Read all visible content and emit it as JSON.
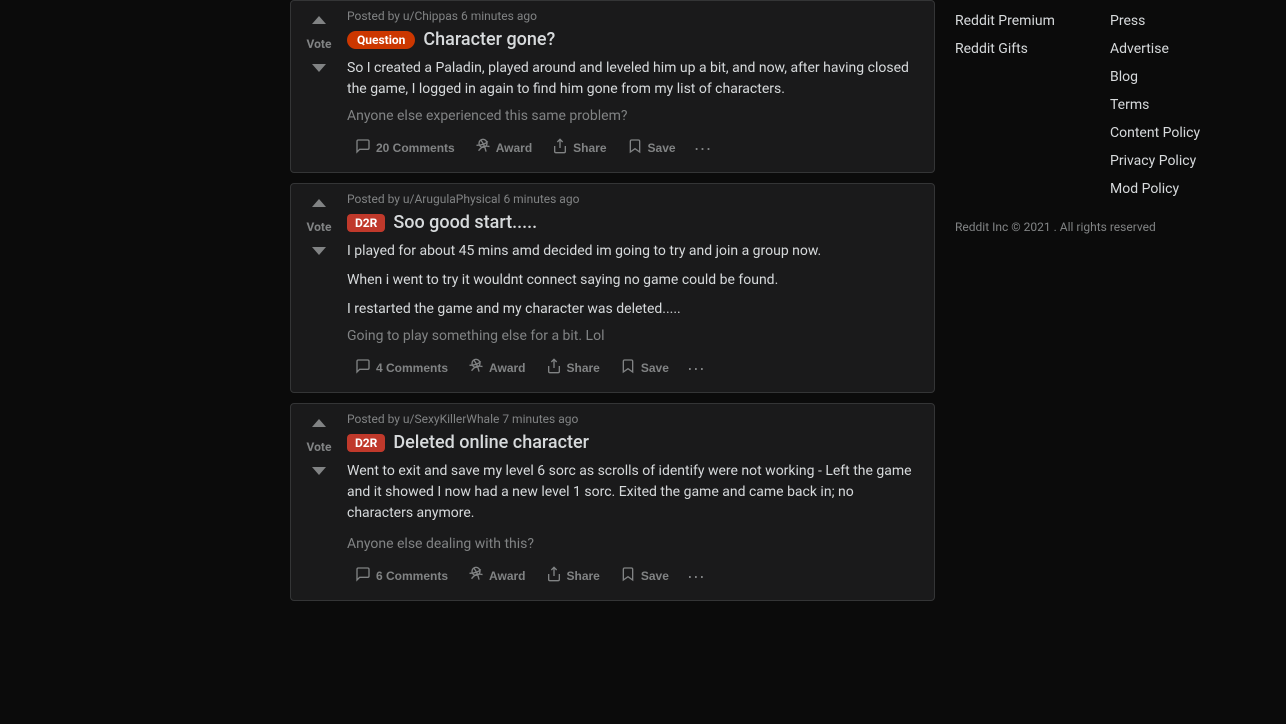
{
  "sidebar": {
    "links_col1": [
      {
        "label": "Reddit Premium",
        "name": "reddit-premium-link"
      },
      {
        "label": "Reddit Gifts",
        "name": "reddit-gifts-link"
      }
    ],
    "links_col2": [
      {
        "label": "Press",
        "name": "press-link"
      },
      {
        "label": "Advertise",
        "name": "advertise-link"
      },
      {
        "label": "Blog",
        "name": "blog-link"
      },
      {
        "label": "Terms",
        "name": "terms-link"
      },
      {
        "label": "Content Policy",
        "name": "content-policy-link"
      },
      {
        "label": "Privacy Policy",
        "name": "privacy-policy-link"
      },
      {
        "label": "Mod Policy",
        "name": "mod-policy-link"
      }
    ],
    "footer": "Reddit Inc © 2021 . All rights reserved"
  },
  "posts": [
    {
      "id": "post-1",
      "meta": "Posted by u/Chippas 6 minutes ago",
      "flair": "Question",
      "flair_type": "question",
      "title": "Character gone?",
      "body1": "So I created a Paladin, played around and leveled him up a bit, and now, after having closed the game, I logged in again to find him gone from my list of characters.",
      "subtext": "Anyone else experienced this same problem?",
      "comments_label": "20 Comments",
      "award_label": "Award",
      "share_label": "Share",
      "save_label": "Save"
    },
    {
      "id": "post-2",
      "meta": "Posted by u/ArugulaPhysical 6 minutes ago",
      "flair": "D2R",
      "flair_type": "d2r",
      "title": "Soo good start.....",
      "body1": "I played for about 45 mins amd decided im going to try and join a group now.",
      "body2": "When i went to try it wouldnt connect saying no game could be found.",
      "body3": "I restarted the game and my character was deleted.....",
      "subtext": "Going to play something else for a bit. Lol",
      "comments_label": "4 Comments",
      "award_label": "Award",
      "share_label": "Share",
      "save_label": "Save"
    },
    {
      "id": "post-3",
      "meta": "Posted by u/SexyKillerWhale 7 minutes ago",
      "flair": "D2R",
      "flair_type": "d2r",
      "title": "Deleted online character",
      "body1": "Went to exit and save my level 6 sorc as scrolls of identify were not working - Left the game and it showed I now had a new level 1 sorc. Exited the game and came back in; no characters anymore.",
      "subtext": "Anyone else dealing with this?",
      "comments_label": "6 Comments",
      "award_label": "Award",
      "share_label": "Share",
      "save_label": "Save"
    }
  ],
  "vote_label": "Vote",
  "dots": "···"
}
